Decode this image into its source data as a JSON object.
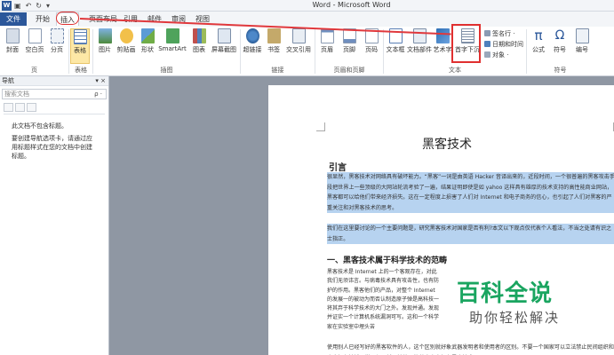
{
  "window": {
    "title": "Word - Microsoft Word",
    "app_logo": "W"
  },
  "qat": {
    "save": "▣",
    "undo": "↶",
    "redo": "↻",
    "more": "▾"
  },
  "tabs": [
    {
      "label": "文件"
    },
    {
      "label": "开始"
    },
    {
      "label": "插入"
    },
    {
      "label": "页面布局"
    },
    {
      "label": "引用"
    },
    {
      "label": "邮件"
    },
    {
      "label": "审阅"
    },
    {
      "label": "视图"
    }
  ],
  "ribbon": {
    "buttons": [
      {
        "label": "封面"
      },
      {
        "label": "空白页"
      },
      {
        "label": "分页"
      },
      {
        "label": "表格"
      },
      {
        "label": "图片"
      },
      {
        "label": "剪贴画"
      },
      {
        "label": "形状"
      },
      {
        "label": "SmartArt"
      },
      {
        "label": "图表"
      },
      {
        "label": "屏幕截图"
      },
      {
        "label": "超链接"
      },
      {
        "label": "书签"
      },
      {
        "label": "交叉引用"
      },
      {
        "label": "页眉"
      },
      {
        "label": "页脚"
      },
      {
        "label": "页码"
      },
      {
        "label": "文本框"
      },
      {
        "label": "文档部件"
      },
      {
        "label": "艺术字"
      },
      {
        "label": "首字下沉"
      },
      {
        "label": "公式"
      },
      {
        "label": "符号"
      },
      {
        "label": "编号"
      }
    ],
    "small_cmds": [
      "签名行 ·",
      "日期和时间",
      "对象 ·"
    ],
    "groups": [
      "页",
      "表格",
      "插图",
      "链接",
      "页眉和页脚",
      "文本",
      "符号"
    ]
  },
  "nav": {
    "header": "导航",
    "controls": "▾ ×",
    "search_placeholder": "搜索文档",
    "search_icon": "ρ ·",
    "message_1": "此文档不包含标题。",
    "message_2": "要创建导航选项卡，请通过应用标题样式在您的文档中创建标题。"
  },
  "doc": {
    "title": "黑客技术",
    "heading_intro": "引言",
    "para_selected_1": "很显然，黑客技术对网络具有破坏能力。“黑客”一词是由英语 Hacker 音译出来的，近段时间，一个很普遍的黑客攻击手段把世界上一些顶级的大网站轮流考验了一遍，结果证明即使是如 yahoo 这样具有雄厚的技术支持的高性能商业网站，黑客都可以给他们带来经济损失。这在一定程度上损害了人们对 Internet 和电子商务的信心，也引起了人们对黑客的严重关注和对黑客技术的思考。",
    "para_selected_2": "我们在这里要讨论的一个主要问题是，研究黑客技术对国家是否有利?本文以下观点仅代表个人看法，不当之处请有识之士指正。",
    "heading_1": "一、黑客技术属于科学技术的范畴",
    "para_narrow": "黑客技术是 Internet 上的一个客观存在，对此我们无须讳言。与病毒技术具有攻击性，也有防护的作用。黑客他们的产品，对整个 Internet 的发展一的被动为而否认制造原子弹是高科技一将其弃于科学技术的大门之外。发现并通。发现并证实一个计算机系统漏洞可写。这和一个科学家在实验室中埋头苦",
    "para_last": "使用别人已经写好的黑客软件的人，这个区别就好象武器发明者和使用者的区别。不要一个国家可以立法禁止民间组织和个人拥有枪械一样，很显然，法律不能禁止个人拥有黑客技术"
  },
  "watermark": {
    "title": "百科全说",
    "subtitle": "助你轻松解决"
  },
  "colors": {
    "file_tab": "#2b579a",
    "selection": "#b7d3f0",
    "annotation": "#e03030",
    "watermark": "#1aa560"
  }
}
